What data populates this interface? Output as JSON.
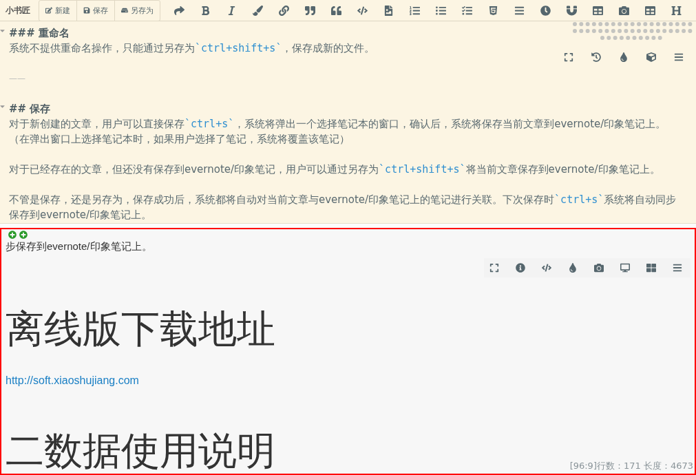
{
  "toolbar": {
    "logo": "小书匠",
    "buttons": [
      {
        "label": "新建",
        "kind": "new"
      },
      {
        "label": "保存",
        "kind": "save"
      },
      {
        "label": "另存为",
        "kind": "saveas"
      }
    ]
  },
  "editor": {
    "blocks": [
      {
        "kind": "heading",
        "text": "### 重命名"
      },
      {
        "kind": "para",
        "segments": [
          {
            "text": "系统不提供重命名操作，只能通过另存为",
            "code": false
          },
          {
            "text": "`ctrl+shift+s`",
            "code": true
          },
          {
            "text": "，保存成新的文件。",
            "code": false
          }
        ]
      },
      {
        "kind": "blank"
      },
      {
        "kind": "rule",
        "text": "——"
      },
      {
        "kind": "blank"
      },
      {
        "kind": "heading",
        "text": "## 保存"
      },
      {
        "kind": "para",
        "segments": [
          {
            "text": "对于新创建的文章，用户可以直接保存",
            "code": false
          },
          {
            "text": "`ctrl+s`",
            "code": true
          },
          {
            "text": "，系统将弹出一个选择笔记本的窗口，确认后，系统将保存当前文章到evernote/印象笔记上。（在弹出窗口上选择笔记本时，如果用户选择了笔记，系统将覆盖该笔记）",
            "code": false
          }
        ]
      },
      {
        "kind": "blank"
      },
      {
        "kind": "para",
        "segments": [
          {
            "text": "对于已经存在的文章，但还没有保存到evernote/印象笔记，用户可以通过另存为",
            "code": false
          },
          {
            "text": "`ctrl+shift+s`",
            "code": true
          },
          {
            "text": "将当前文章保存到evernote/印象笔记上。",
            "code": false
          }
        ]
      },
      {
        "kind": "blank"
      },
      {
        "kind": "para",
        "segments": [
          {
            "text": "不管是保存，还是另存为，保存成功后，系统都将自动对当前文章与evernote/印象笔记上的笔记进行关联。下次保存时",
            "code": false
          },
          {
            "text": "`ctrl+s`",
            "code": true
          },
          {
            "text": "系统将自动同步保存到evernote/印象笔记上。",
            "code": false
          }
        ]
      }
    ]
  },
  "preview": {
    "first_line": "步保存到evernote/印象笔记上。",
    "heading": "离线版下载地址",
    "link": "http://soft.xiaoshujiang.com",
    "next_heading": "二数据使用说明",
    "status": "[96:9]行数：171 长度：4673"
  }
}
